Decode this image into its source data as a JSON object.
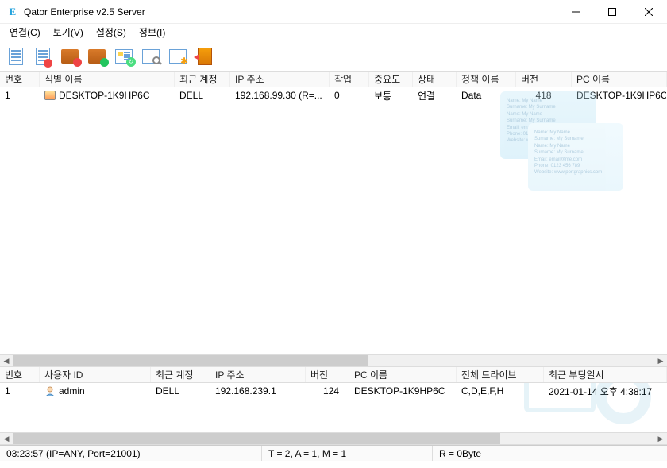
{
  "window": {
    "title": "Qator Enterprise v2.5 Server"
  },
  "menu": {
    "connect": "연결(C)",
    "view": "보기(V)",
    "settings": "설정(S)",
    "info": "정보(I)"
  },
  "top_grid": {
    "headers": {
      "no": "번호",
      "ident": "식별 이름",
      "account": "최근 계정",
      "ip": "IP 주소",
      "job": "작업",
      "priority": "중요도",
      "state": "상태",
      "policy": "정책 이름",
      "version": "버전",
      "pcname": "PC 이름"
    },
    "rows": [
      {
        "no": "1",
        "ident": "DESKTOP-1K9HP6C",
        "account": "DELL",
        "ip": "192.168.99.30 (R=...",
        "job": "0",
        "priority": "보통",
        "state": "연결",
        "policy": "Data",
        "version": "418",
        "pcname": "DESKTOP-1K9HP6C"
      }
    ]
  },
  "bottom_grid": {
    "headers": {
      "no": "번호",
      "user": "사용자 ID",
      "account": "최근 계정",
      "ip": "IP 주소",
      "version": "버전",
      "pcname": "PC 이름",
      "drives": "전체 드라이브",
      "lastboot": "최근 부팅일시"
    },
    "rows": [
      {
        "no": "1",
        "user": "admin",
        "account": "DELL",
        "ip": "192.168.239.1",
        "version": "124",
        "pcname": "DESKTOP-1K9HP6C",
        "drives": "C,D,E,F,H",
        "lastboot": "2021-01-14 오후 4:38:17"
      }
    ]
  },
  "status": {
    "left": "03:23:57 (IP=ANY, Port=21001)",
    "mid": "T = 2, A = 1, M = 1",
    "right": "R = 0Byte"
  }
}
